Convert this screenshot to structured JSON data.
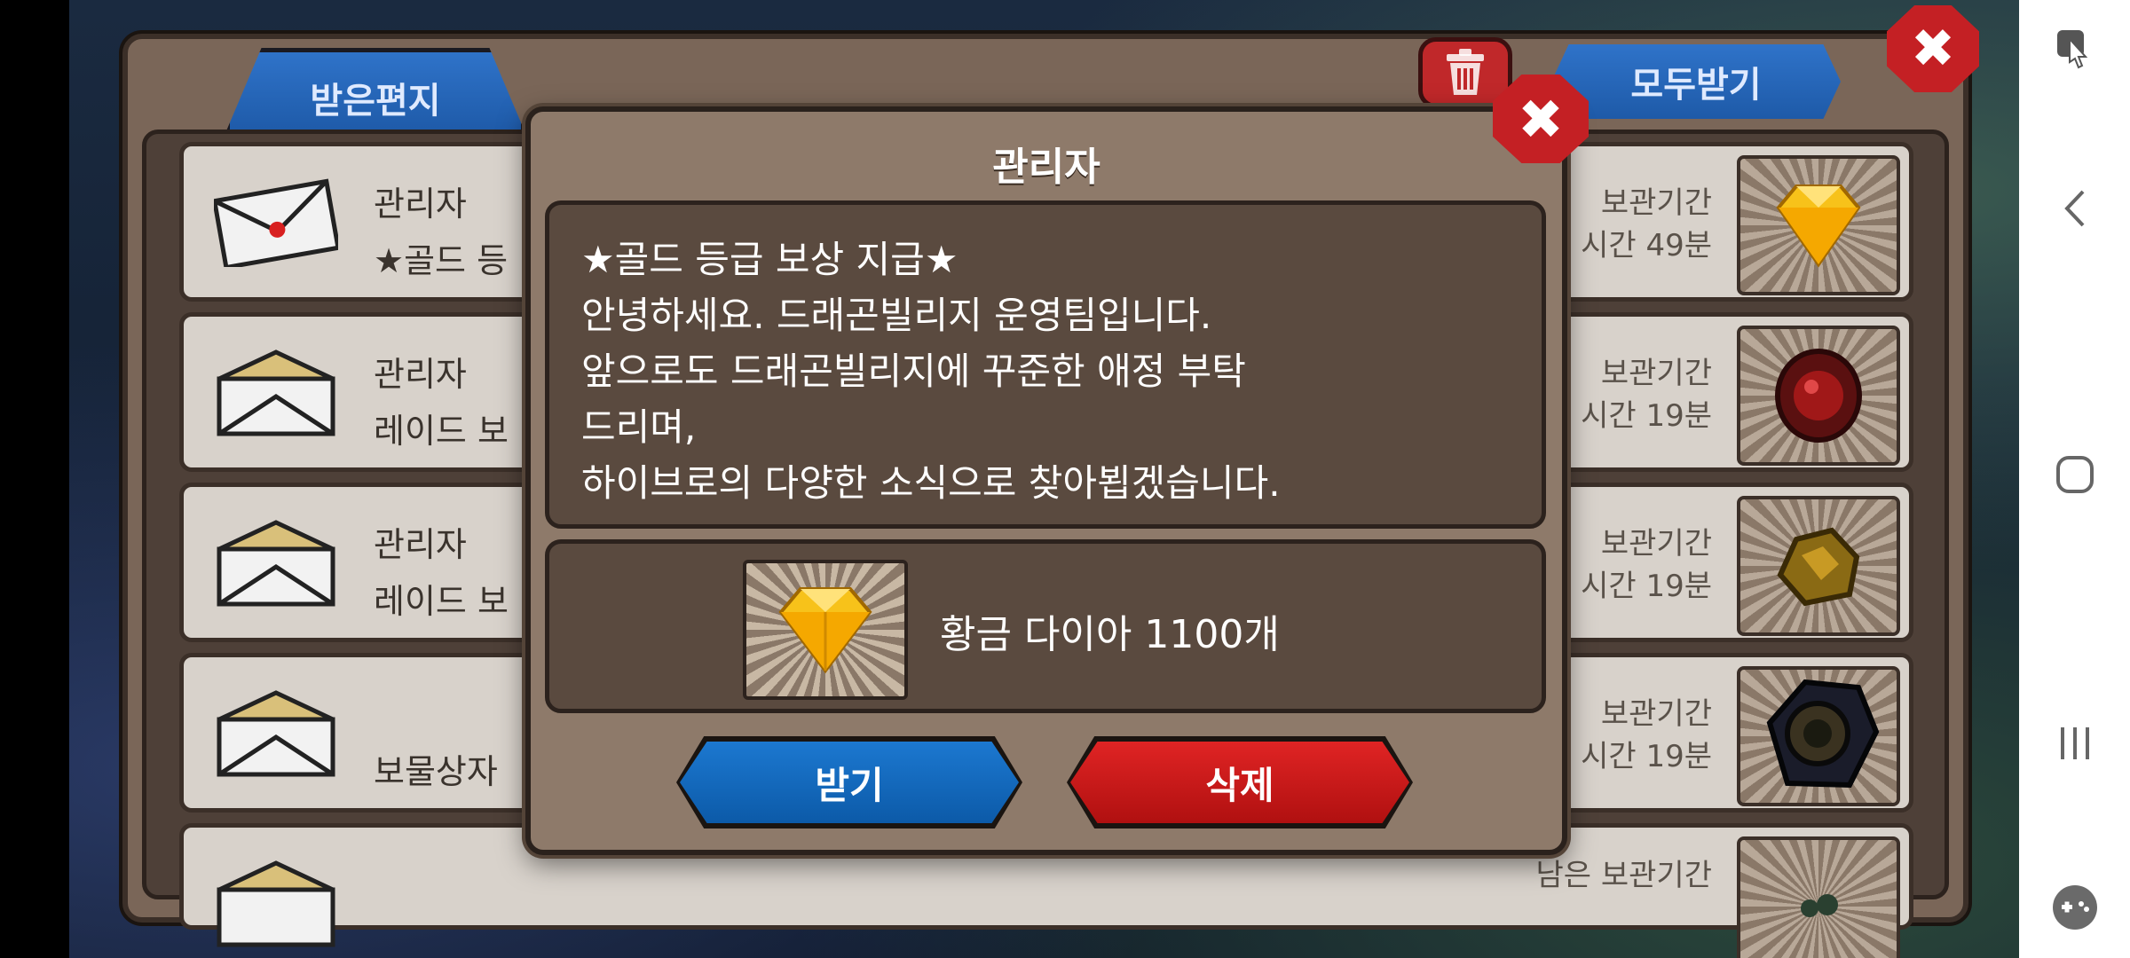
{
  "mailbox": {
    "tab_label": "받은편지",
    "receive_all_label": "모두받기"
  },
  "mails": [
    {
      "sender": "관리자",
      "subject": "★골드 등",
      "keep_label": "보관기간",
      "keep_time": "시간 49분",
      "item_icon": "gold-diamond-icon",
      "opened": false
    },
    {
      "sender": "관리자",
      "subject": "레이드 보",
      "keep_label": "보관기간",
      "keep_time": "시간 19분",
      "item_icon": "red-gem-icon",
      "opened": true
    },
    {
      "sender": "관리자",
      "subject": "레이드 보",
      "keep_label": "보관기간",
      "keep_time": "시간 19분",
      "item_icon": "gold-ore-icon",
      "opened": true
    },
    {
      "sender": "",
      "subject": "보물상자",
      "keep_label": "보관기간",
      "keep_time": "시간 19분",
      "item_icon": "dark-egg-icon",
      "opened": true
    },
    {
      "sender": "",
      "subject": "",
      "keep_label": "남은 보관기간",
      "keep_time": "",
      "item_icon": "green-item-icon",
      "opened": true
    }
  ],
  "dialog": {
    "title": "관리자",
    "message_lines": [
      "★골드 등급 보상 지급★",
      "안녕하세요. 드래곤빌리지 운영팀입니다.",
      "앞으로도 드래곤빌리지에 꾸준한 애정 부탁",
      "드리며,",
      "하이브로의 다양한 소식으로 찾아뵙겠습니다."
    ],
    "reward_label": "황금 다이아 1100개",
    "reward_icon": "gold-diamond-icon",
    "accept_label": "받기",
    "delete_label": "삭제"
  },
  "colors": {
    "accept": "#1c78d0",
    "delete": "#e02424",
    "panel": "#7a6658"
  }
}
